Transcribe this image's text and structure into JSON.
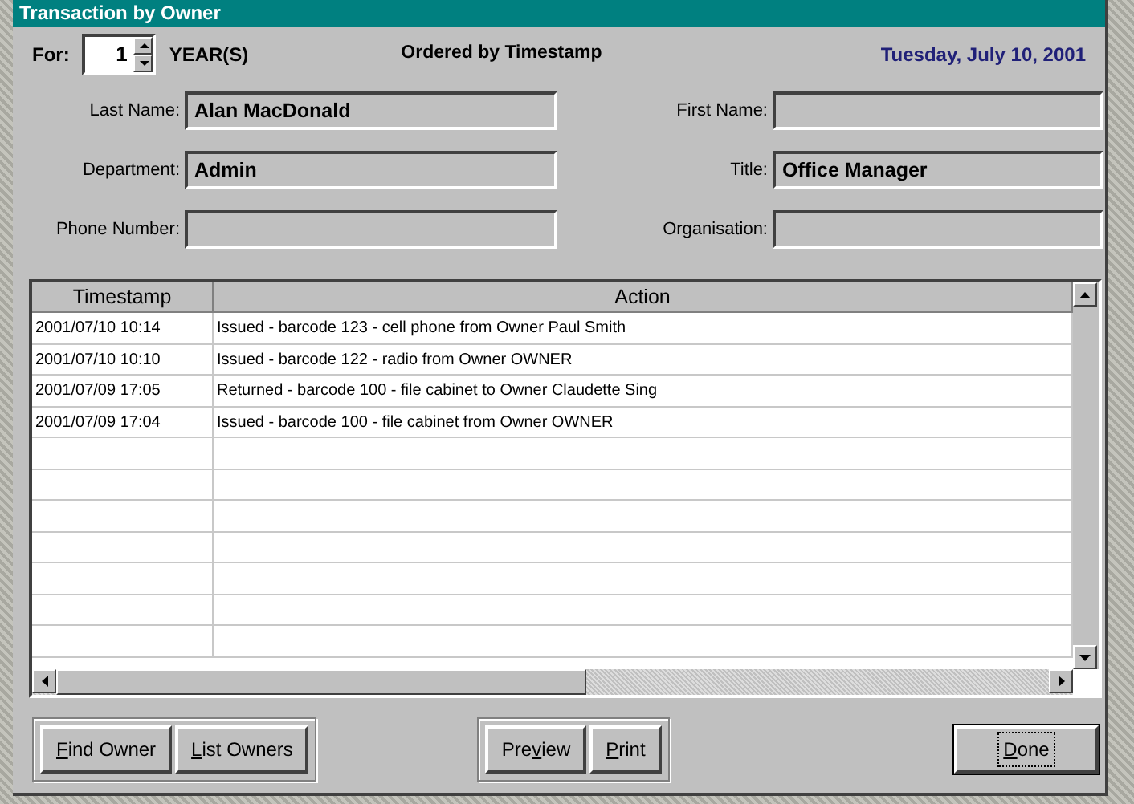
{
  "window": {
    "title": "Transaction by Owner"
  },
  "period": {
    "label": "For:",
    "value": "1",
    "unit": "YEAR(S)"
  },
  "order_caption": "Ordered by Timestamp",
  "date": "Tuesday, July 10, 2001",
  "fields": [
    {
      "label": "Last Name:",
      "value": "Alan MacDonald"
    },
    {
      "label": "First Name:"
    },
    {
      "label": "Department:",
      "value": "Admin"
    },
    {
      "label": "Title:",
      "value": "Office Manager"
    },
    {
      "label": "Phone Number:"
    },
    {
      "label": "Organisation:"
    }
  ],
  "table": {
    "columns": [
      "Timestamp",
      "Action"
    ],
    "rows": [
      [
        "2001/07/10 10:14",
        "Issued - barcode 123 - cell phone from Owner Paul Smith"
      ],
      [
        "2001/07/10 10:10",
        "Issued - barcode 122 - radio from Owner OWNER"
      ],
      [
        "2001/07/09 17:05",
        "Returned - barcode 100 - file cabinet to Owner Claudette Sing"
      ],
      [
        "2001/07/09 17:04",
        "Issued - barcode 100 - file cabinet from Owner OWNER"
      ]
    ]
  },
  "button_groups": [
    [
      {
        "key": "F",
        "post": "ind Owner",
        "default": false
      },
      {
        "key": "L",
        "post": "ist Owners",
        "default": false
      }
    ],
    [
      {
        "pre": "Pre",
        "key": "v",
        "post": "iew",
        "default": false
      },
      {
        "key": "P",
        "post": "rint",
        "default": false
      }
    ],
    [
      {
        "key": "D",
        "post": "one",
        "default": true
      }
    ]
  ]
}
